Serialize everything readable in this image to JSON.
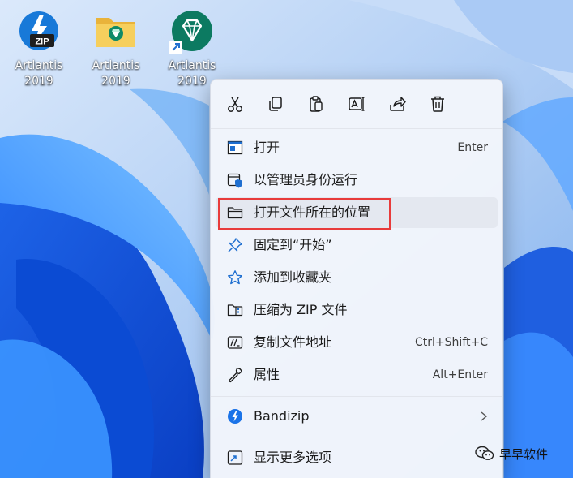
{
  "desktop": {
    "icons": [
      {
        "label": "Artlantis\n2019",
        "icon": "zip-archive-icon"
      },
      {
        "label": "Artlantis\n2019",
        "icon": "folder-icon"
      },
      {
        "label": "Artlantis\n2019",
        "icon": "artlantis-app-icon",
        "shortcut": true
      }
    ]
  },
  "context_menu": {
    "toolbar": [
      {
        "name": "cut-icon"
      },
      {
        "name": "copy-icon"
      },
      {
        "name": "paste-icon"
      },
      {
        "name": "rename-icon"
      },
      {
        "name": "share-icon"
      },
      {
        "name": "delete-icon"
      }
    ],
    "items": [
      {
        "label": "打开",
        "shortcut": "Enter",
        "icon": "open-window-icon"
      },
      {
        "label": "以管理员身份运行",
        "shortcut": "",
        "icon": "run-as-admin-shield-icon"
      },
      {
        "label": "打开文件所在的位置",
        "shortcut": "",
        "icon": "folder-outline-icon",
        "highlighted": true
      },
      {
        "label": "固定到“开始”",
        "shortcut": "",
        "icon": "pin-icon"
      },
      {
        "label": "添加到收藏夹",
        "shortcut": "",
        "icon": "star-icon"
      },
      {
        "label": "压缩为 ZIP 文件",
        "shortcut": "",
        "icon": "zip-folder-icon"
      },
      {
        "label": "复制文件地址",
        "shortcut": "Ctrl+Shift+C",
        "icon": "copy-path-icon"
      },
      {
        "label": "属性",
        "shortcut": "Alt+Enter",
        "icon": "wrench-icon"
      }
    ],
    "bandizip": {
      "label": "Bandizip",
      "icon": "bandizip-icon"
    },
    "more": {
      "label": "显示更多选项",
      "icon": "more-options-icon"
    }
  },
  "watermark": {
    "text": "早早软件"
  },
  "colors": {
    "accent": "#0067c0",
    "highlight_border": "#e83b3b",
    "menu_bg": "#f2f5fb"
  }
}
